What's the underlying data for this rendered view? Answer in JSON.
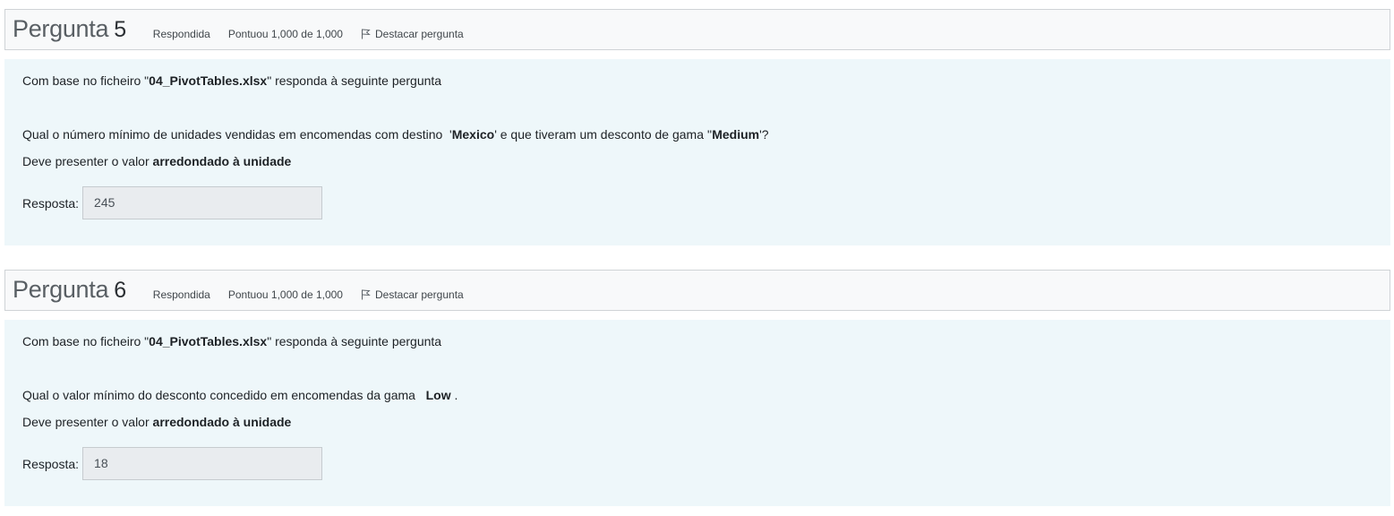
{
  "questions": [
    {
      "title_prefix": "Pergunta",
      "number": "5",
      "status": "Respondida",
      "grade": "Pontuou 1,000 de 1,000",
      "flag_label": "Destacar pergunta",
      "intro": {
        "pre": "Com base no ficheiro \"",
        "file": "04_PivotTables.xlsx",
        "post": "\" responda à seguinte pergunta"
      },
      "question": {
        "pre": "Qual o número mínimo de unidades vendidas em encomendas com destino  '",
        "bold1": "Mexico",
        "mid": "' e que tiveram um desconto de gama ''",
        "bold2": "Medium",
        "post": "'?"
      },
      "instruction": {
        "pre": "Deve presenter o valor ",
        "bold": "arredondado à unidade"
      },
      "answer_label": "Resposta:",
      "answer_value": "245"
    },
    {
      "title_prefix": "Pergunta",
      "number": "6",
      "status": "Respondida",
      "grade": "Pontuou 1,000 de 1,000",
      "flag_label": "Destacar pergunta",
      "intro": {
        "pre": "Com base no ficheiro \"",
        "file": "04_PivotTables.xlsx",
        "post": "\" responda à seguinte pergunta"
      },
      "question": {
        "pre": "Qual o valor mínimo do desconto concedido em encomendas da gama   ",
        "bold1": "Low",
        "post": " ."
      },
      "instruction": {
        "pre": "Deve presenter o valor ",
        "bold": "arredondado à unidade"
      },
      "answer_label": "Resposta:",
      "answer_value": "18"
    }
  ],
  "icons": {
    "flag": "flag-icon"
  }
}
